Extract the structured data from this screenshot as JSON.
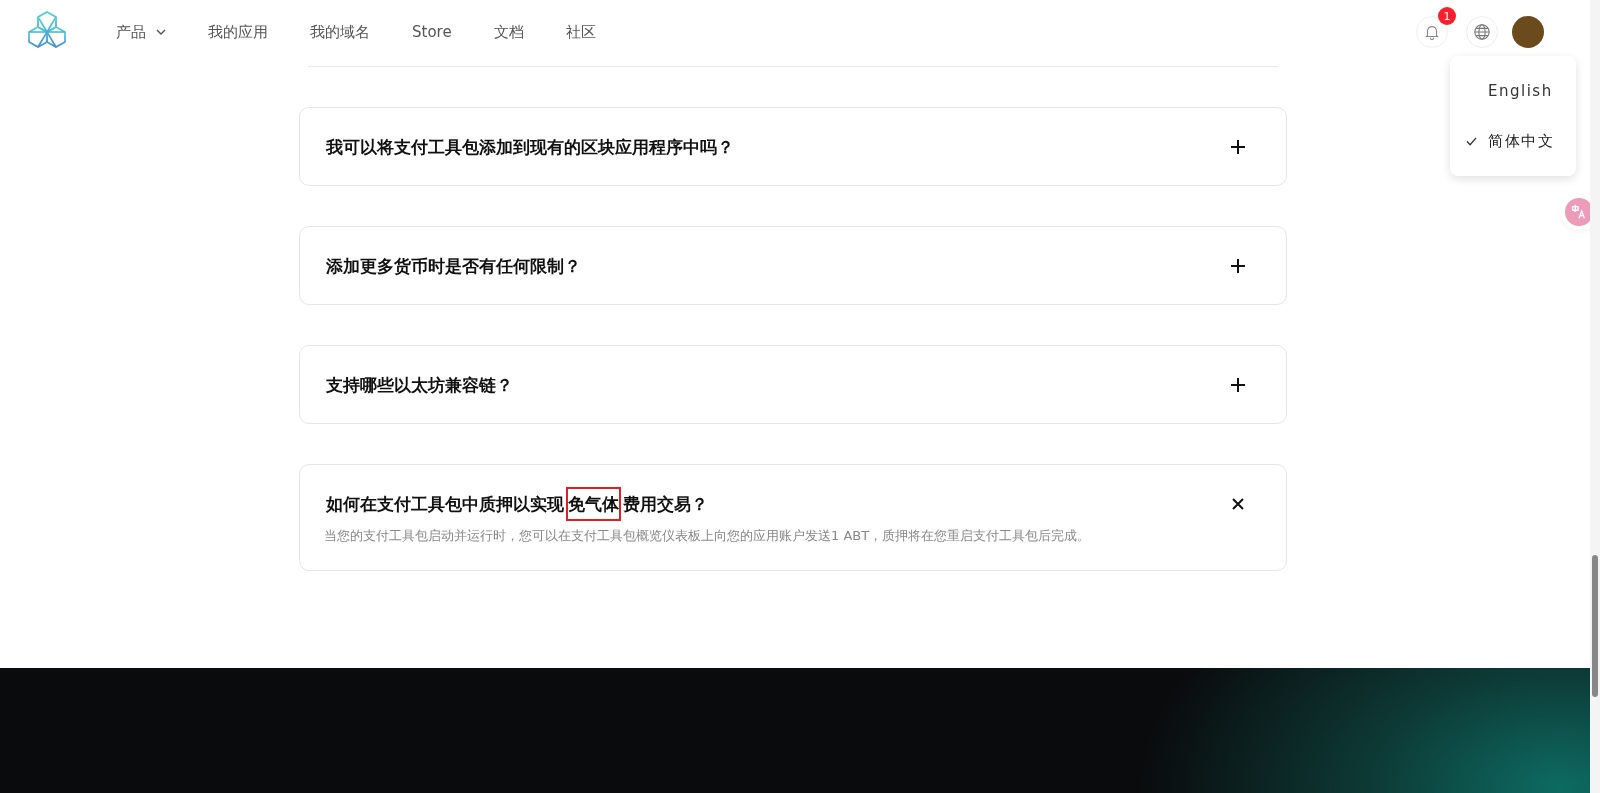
{
  "nav": {
    "items": [
      {
        "label": "产品",
        "has_menu": true
      },
      {
        "label": "我的应用",
        "has_menu": false
      },
      {
        "label": "我的域名",
        "has_menu": false
      },
      {
        "label": "Store",
        "has_menu": false
      },
      {
        "label": "文档",
        "has_menu": false
      },
      {
        "label": "社区",
        "has_menu": false
      }
    ]
  },
  "notifications": {
    "count": "1"
  },
  "language_menu": {
    "items": [
      {
        "label": "English",
        "selected": false
      },
      {
        "label": "简体中文",
        "selected": true
      }
    ]
  },
  "faq": [
    {
      "question": [
        {
          "text": "我可以将支付工具包添加到现有的区块应用程序中吗？",
          "highlighted": false
        }
      ],
      "expanded": false
    },
    {
      "question": [
        {
          "text": "添加更多货币时是否有任何限制？",
          "highlighted": false
        }
      ],
      "expanded": false
    },
    {
      "question": [
        {
          "text": "支持哪些以太坊兼容链？",
          "highlighted": false
        }
      ],
      "expanded": false
    },
    {
      "question": [
        {
          "text": "如何在支付工具包中质押以实现",
          "highlighted": false
        },
        {
          "text": "免气体",
          "highlighted": true
        },
        {
          "text": "费用交易？",
          "highlighted": false
        }
      ],
      "expanded": true,
      "answer": "当您的支付工具包启动并运行时，您可以在支付工具包概览仪表板上向您的应用账户发送1 ABT，质押将在您重启支付工具包后完成。"
    }
  ]
}
